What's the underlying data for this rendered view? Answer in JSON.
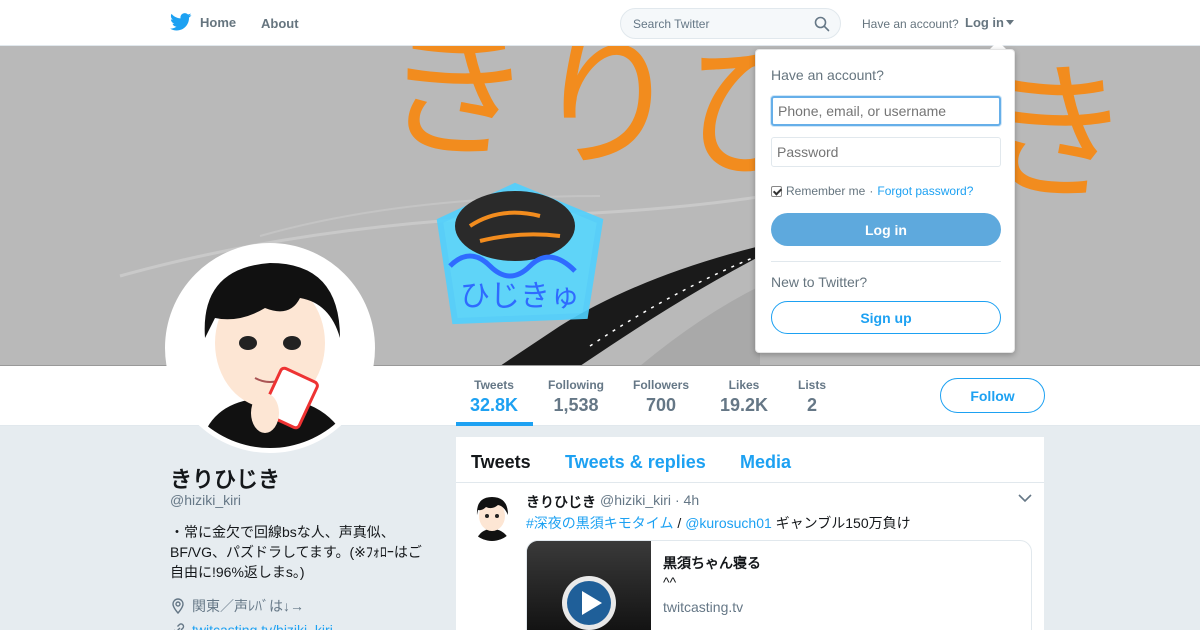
{
  "nav": {
    "home_label": "Home",
    "about_label": "About",
    "search_placeholder": "Search Twitter",
    "have_account": "Have an account?",
    "login_label": "Log in"
  },
  "banner": {
    "text": "きりひじき",
    "bowl_text": "ひじきゅ"
  },
  "profile": {
    "name": "きりひじき",
    "handle": "@hiziki_kiri",
    "bio": "・常に金欠で回線bsな人、声真似、BF/VG、パズドラしてます。(※ﾌｫﾛｰはご自由に!96%返しまs。)",
    "location": "関東／声ﾚﾊﾞは↓→",
    "url": "twitcasting.tv/hiziki_kiri"
  },
  "stats": [
    {
      "label": "Tweets",
      "value": "32.8K",
      "active": true
    },
    {
      "label": "Following",
      "value": "1,538",
      "active": false
    },
    {
      "label": "Followers",
      "value": "700",
      "active": false
    },
    {
      "label": "Likes",
      "value": "19.2K",
      "active": false
    },
    {
      "label": "Lists",
      "value": "2",
      "active": false
    }
  ],
  "follow_label": "Follow",
  "timeline": {
    "tabs": [
      "Tweets",
      "Tweets & replies",
      "Media"
    ],
    "tweet": {
      "author": "きりひじき",
      "handle": "@hiziki_kiri",
      "time": "· 4h",
      "hashtag": "#深夜の黒須キモタイム",
      "separator": "/",
      "mention": "@kurosuch01",
      "text": "ギャンブル150万負け",
      "card": {
        "title": "黒須ちゃん寝る",
        "description": "^^",
        "domain": "twitcasting.tv"
      }
    }
  },
  "login_dropdown": {
    "title": "Have an account?",
    "username_placeholder": "Phone, email, or username",
    "password_placeholder": "Password",
    "remember_label": "Remember me",
    "dot": "·",
    "forgot_label": "Forgot password?",
    "login_button": "Log in",
    "new_to_twitter": "New to Twitter?",
    "signup_button": "Sign up"
  },
  "colors": {
    "accent": "#1da1f2",
    "login_button": "#5ea9dd",
    "banner_bg": "#b9b9b9",
    "banner_text": "#f28c1e"
  }
}
